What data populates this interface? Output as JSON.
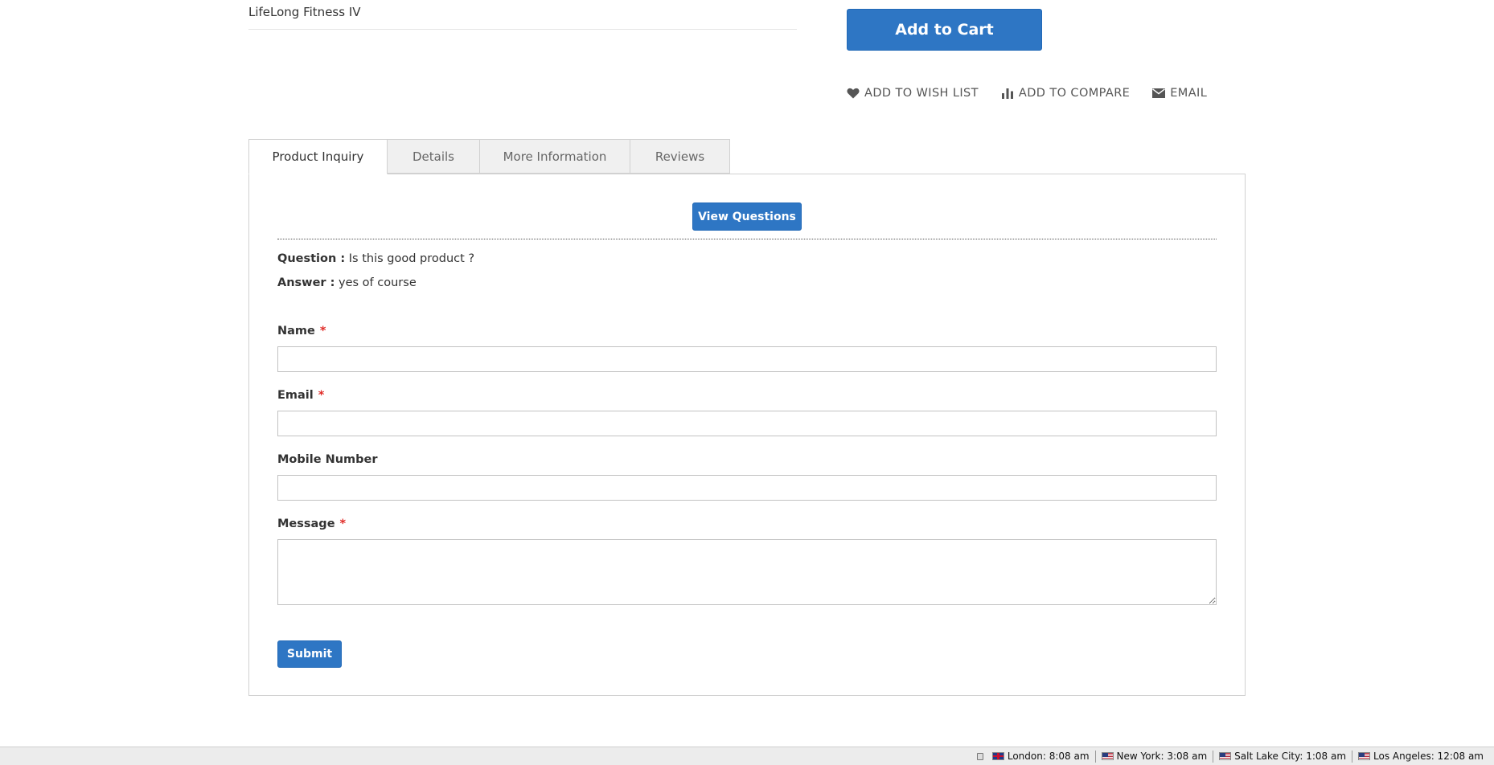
{
  "product": {
    "option_name": "LifeLong Fitness IV",
    "add_to_cart_label": "Add to Cart"
  },
  "actions": {
    "wishlist": "Add to Wish List",
    "compare": "Add to Compare",
    "email": "Email"
  },
  "tabs": [
    {
      "label": "Product Inquiry",
      "active": true
    },
    {
      "label": "Details",
      "active": false
    },
    {
      "label": "More Information",
      "active": false
    },
    {
      "label": "Reviews",
      "active": false
    }
  ],
  "inquiry": {
    "view_questions_label": "View Questions",
    "question_label": "Question :",
    "question_text": "Is this good product ?",
    "answer_label": "Answer :",
    "answer_text": "yes of course",
    "required_mark": "*",
    "fields": {
      "name": "Name",
      "email": "Email",
      "mobile": "Mobile Number",
      "message": "Message"
    },
    "submit_label": "Submit"
  },
  "statusbar": {
    "clocks": [
      {
        "city_time": "London: 8:08 am",
        "flag": "uk-flag-icon"
      },
      {
        "city_time": "New York: 3:08 am",
        "flag": "us-flag-icon"
      },
      {
        "city_time": "Salt Lake City: 1:08 am",
        "flag": "us-flag-icon"
      },
      {
        "city_time": "Los Angeles: 12:08 am",
        "flag": "us-flag-icon"
      }
    ]
  },
  "colors": {
    "primary_button": "#2e76c4",
    "required": "#e02b27"
  }
}
